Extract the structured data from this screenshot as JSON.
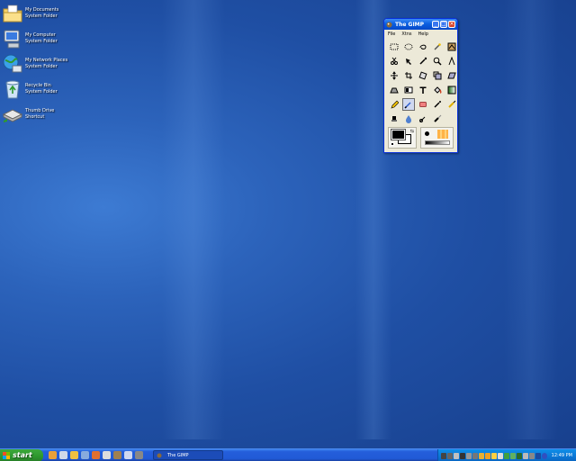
{
  "desktop": {
    "icons": [
      {
        "name": "My Documents",
        "type": "System Folder"
      },
      {
        "name": "My Computer",
        "type": "System Folder"
      },
      {
        "name": "My Network Places",
        "type": "System Folder"
      },
      {
        "name": "Recycle Bin",
        "type": "System Folder"
      },
      {
        "name": "Thumb Drive",
        "type": "Shortcut"
      }
    ]
  },
  "gimp_window": {
    "title": "The GIMP",
    "menu": [
      "File",
      "Xtns",
      "Help"
    ],
    "tools": [
      "rect-select-icon",
      "ellipse-select-icon",
      "free-select-icon",
      "fuzzy-select-icon",
      "bezier-select-icon",
      "intelligent-scissors-icon",
      "move-icon",
      "color-picker-icon",
      "magnify-icon",
      "measure-icon",
      "transform-icon",
      "crop-icon",
      "rotate-icon",
      "scale-icon",
      "shear-icon",
      "perspective-icon",
      "flip-icon",
      "text-icon",
      "bucket-fill-icon",
      "blend-icon",
      "pencil-icon",
      "paintbrush-icon",
      "eraser-icon",
      "airbrush-icon",
      "ink-icon",
      "clone-icon",
      "smudge-icon",
      "dodge-burn-icon",
      "convolve-icon"
    ],
    "selected_tool": "paintbrush-icon",
    "foreground_color": "#000000",
    "background_color": "#ffffff"
  },
  "taskbar": {
    "start_label": "start",
    "quick_launch": [
      "ie-icon",
      "media-player-icon",
      "folder-icon",
      "paint-icon",
      "network-icon",
      "tool-icon",
      "gimp-icon",
      "messenger-icon",
      "brush-icon"
    ],
    "task_button": "The GIMP",
    "clock": "12:49 PM"
  },
  "colors": {
    "accent": "#245edb",
    "start_green": "#2f9a2f",
    "tray_blue": "#0b7ad8"
  }
}
